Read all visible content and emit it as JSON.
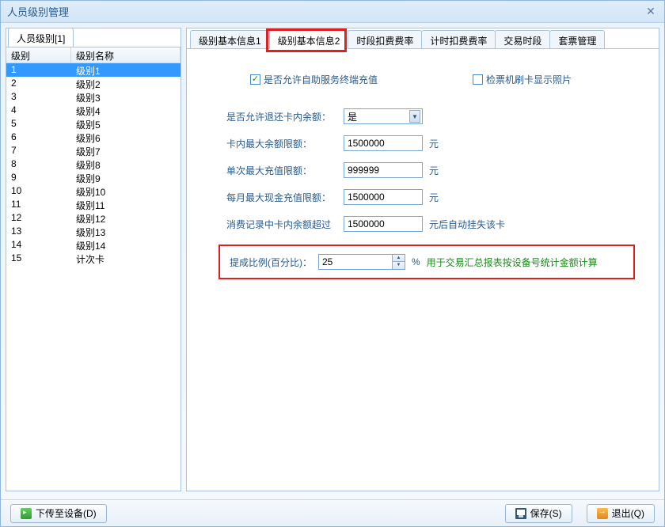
{
  "window": {
    "title": "人员级别管理"
  },
  "left": {
    "tab_label": "人员级别[1]",
    "columns": {
      "col1": "级别",
      "col2": "级别名称"
    },
    "rows": [
      {
        "id": "1",
        "name": "级别1"
      },
      {
        "id": "2",
        "name": "级别2"
      },
      {
        "id": "3",
        "name": "级别3"
      },
      {
        "id": "4",
        "name": "级别4"
      },
      {
        "id": "5",
        "name": "级别5"
      },
      {
        "id": "6",
        "name": "级别6"
      },
      {
        "id": "7",
        "name": "级别7"
      },
      {
        "id": "8",
        "name": "级别8"
      },
      {
        "id": "9",
        "name": "级别9"
      },
      {
        "id": "10",
        "name": "级别10"
      },
      {
        "id": "11",
        "name": "级别11"
      },
      {
        "id": "12",
        "name": "级别12"
      },
      {
        "id": "13",
        "name": "级别13"
      },
      {
        "id": "14",
        "name": "级别14"
      },
      {
        "id": "15",
        "name": "计次卡"
      }
    ],
    "selected_index": 0
  },
  "tabs": {
    "items": [
      "级别基本信息1",
      "级别基本信息2",
      "时段扣费费率",
      "计时扣费费率",
      "交易时段",
      "套票管理"
    ],
    "active_index": 1
  },
  "form": {
    "cb1_label": "是否允许自助服务终端充值",
    "cb1_checked": true,
    "cb2_label": "检票机刷卡显示照片",
    "cb2_checked": false,
    "refund_label": "是否允许退还卡内余额：",
    "refund_value": "是",
    "max_balance_label": "卡内最大余额限额：",
    "max_balance_value": "1500000",
    "unit_yuan": "元",
    "single_recharge_label": "单次最大充值限额：",
    "single_recharge_value": "999999",
    "monthly_cash_label": "每月最大现金充值限额：",
    "monthly_cash_value": "1500000",
    "consume_exceed_label": "消费记录中卡内余额超过",
    "consume_exceed_value": "1500000",
    "consume_exceed_suffix": "元后自动挂失该卡",
    "commission_label": "提成比例(百分比)：",
    "commission_value": "25",
    "pct_sign": "%",
    "commission_note": "用于交易汇总报表按设备号统计金额计算"
  },
  "buttons": {
    "upload": "下传至设备(D)",
    "save": "保存(S)",
    "exit": "退出(Q)"
  }
}
